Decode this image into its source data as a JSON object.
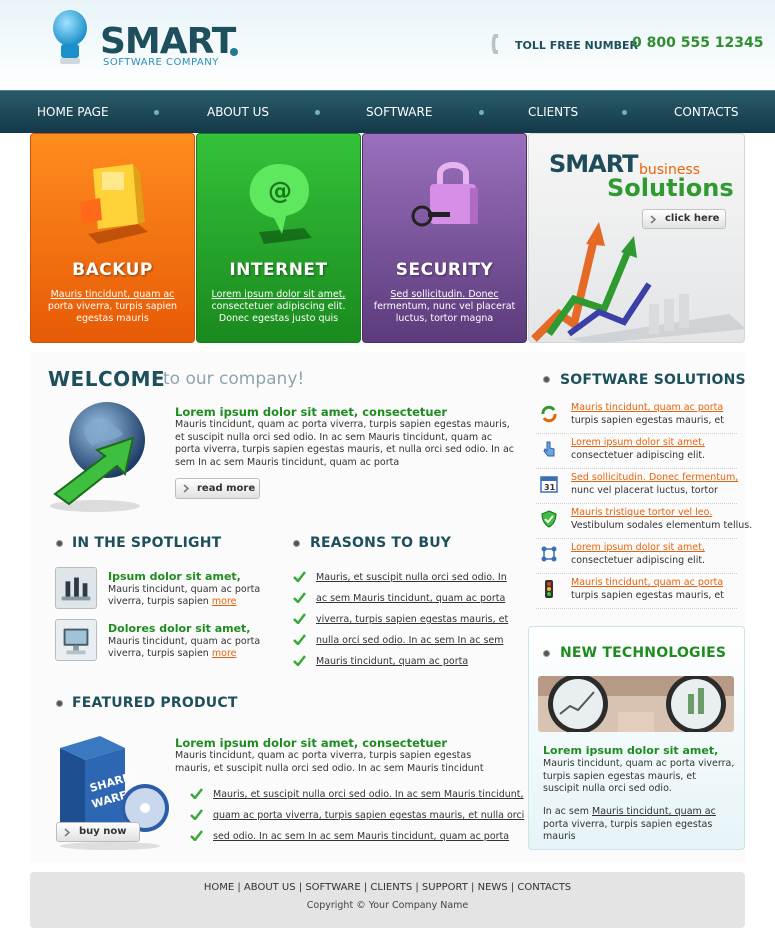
{
  "header": {
    "logo_title": "SMART",
    "logo_subtitle": "SOFTWARE COMPANY",
    "toll_label": "TOLL FREE NUMBER",
    "toll_number": "0 800 555 12345"
  },
  "nav": {
    "items": [
      "HOME PAGE",
      "ABOUT US",
      "SOFTWARE",
      "CLIENTS",
      "CONTACTS"
    ]
  },
  "banners": [
    {
      "title": "BACKUP",
      "link": "Mauris tincidunt, quam ac",
      "text": "porta viverra, turpis sapien egestas mauris",
      "color": "#f07a14"
    },
    {
      "title": "INTERNET",
      "link": "Lorem ipsum dolor sit amet,",
      "text": "consectetuer adipiscing elit. Donec egestas justo quis",
      "color": "#26a82a"
    },
    {
      "title": "SECURITY",
      "link": "Sed sollicitudin. Donec",
      "text": "fermentum, nunc vel placerat luctus, tortor magna",
      "color": "#7b55a0"
    }
  ],
  "promo": {
    "smart": "SMART",
    "business": "business",
    "solutions": "Solutions",
    "button": "click here"
  },
  "welcome": {
    "title": "WELCOME",
    "subtitle": "to our company!",
    "heading": "Lorem ipsum dolor sit amet, consectetuer",
    "text": "Mauris tincidunt, quam ac porta viverra, turpis sapien egestas mauris, et suscipit nulla orci sed odio. In ac sem Mauris tincidunt, quam ac porta viverra, turpis sapien egestas mauris, et nulla orci sed odio. In ac sem In ac sem Mauris tincidunt, quam ac porta",
    "button": "read more"
  },
  "spotlight": {
    "title": "IN THE SPOTLIGHT",
    "items": [
      {
        "heading": "Ipsum dolor sit amet,",
        "line1": "Mauris tincidunt, quam ac porta",
        "line2": "viverra, turpis sapien",
        "more": "more"
      },
      {
        "heading": "Dolores dolor sit amet,",
        "line1": "Mauris tincidunt, quam ac porta",
        "line2": "viverra, turpis sapien",
        "more": "more"
      }
    ]
  },
  "reasons": {
    "title": "REASONS TO BUY",
    "items": [
      "Mauris, et suscipit nulla orci sed odio. In",
      "ac sem Mauris tincidunt, quam ac porta",
      "viverra, turpis sapien egestas mauris, et",
      "nulla orci sed odio. In ac sem In ac sem",
      "Mauris tincidunt, quam ac porta"
    ]
  },
  "featured": {
    "title": "FEATURED PRODUCT",
    "heading": "Lorem ipsum dolor sit amet, consectetuer",
    "text": "Mauris tincidunt, quam ac porta viverra, turpis sapien egestas mauris, et suscipit nulla orci sed odio. In ac sem Mauris tincidunt",
    "bullets": [
      "Mauris, et suscipit nulla orci sed odio. In ac sem Mauris tincidunt,",
      "quam ac porta viverra, turpis sapien egestas mauris, et nulla orci",
      "sed odio. In ac sem In ac sem Mauris tincidunt, quam ac porta"
    ],
    "button": "buy now",
    "box_text_1": "SHARE",
    "box_text_2": "WARE"
  },
  "software_solutions": {
    "title": "SOFTWARE SOLUTIONS",
    "items": [
      {
        "icon": "refresh-icon",
        "link": "Mauris tincidunt, quam ac porta",
        "text": "turpis sapien egestas mauris, et"
      },
      {
        "icon": "pointer-icon",
        "link": "Lorem ipsum dolor sit amet,",
        "text": "consectetuer adipiscing elit."
      },
      {
        "icon": "calendar-icon",
        "link": "Sed sollicitudin. Donec fermentum,",
        "text": "nunc vel placerat luctus, tortor"
      },
      {
        "icon": "shield-icon",
        "link": "Mauris tristique tortor vel leo.",
        "text": "Vestibulum sodales elementum tellus."
      },
      {
        "icon": "network-icon",
        "link": "Lorem ipsum dolor sit amet,",
        "text": "consectetuer adipiscing elit."
      },
      {
        "icon": "traffic-light-icon",
        "link": "Mauris tincidunt, quam ac porta",
        "text": "turpis sapien egestas mauris, et"
      }
    ],
    "calendar_day": "31"
  },
  "new_tech": {
    "title": "NEW TECHNOLOGIES",
    "heading": "Lorem ipsum dolor sit amet,",
    "text": "Mauris tincidunt, quam ac porta viverra, turpis sapien egestas mauris, et suscipit nulla orci sed odio.",
    "text2_prefix": "In ac sem",
    "text2_link": "Mauris tincidunt, quam ac",
    "text2_suffix": "porta viverra, turpis sapien egestas mauris"
  },
  "footer": {
    "links": [
      "HOME",
      "ABOUT US",
      "SOFTWARE",
      "CLIENTS",
      "SUPPORT",
      "NEWS",
      "CONTACTS"
    ],
    "copyright": "Copyright © Your Company Name"
  },
  "colors": {
    "brand_dark": "#1e4f5c",
    "accent_green": "#1f8c1f",
    "accent_orange": "#e8630b"
  }
}
